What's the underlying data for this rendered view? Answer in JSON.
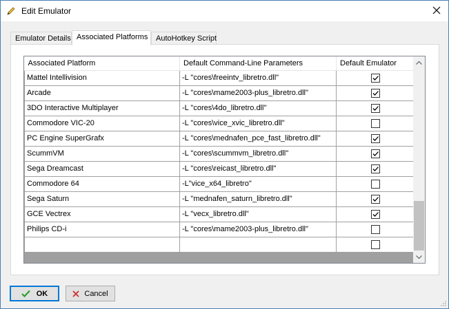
{
  "window": {
    "title": "Edit Emulator",
    "close_glyph": "✕"
  },
  "tabs": [
    {
      "label": "Emulator Details",
      "active": false
    },
    {
      "label": "Associated Platforms",
      "active": true
    },
    {
      "label": "AutoHotkey Script",
      "active": false
    }
  ],
  "grid": {
    "columns": [
      "Associated Platform",
      "Default Command-Line Parameters",
      "Default Emulator"
    ],
    "rows": [
      {
        "platform": "Mattel Intellivision",
        "params": "-L \"cores\\freeintv_libretro.dll\"",
        "default": true
      },
      {
        "platform": "Arcade",
        "params": "-L \"cores\\mame2003-plus_libretro.dll\"",
        "default": true
      },
      {
        "platform": "3DO Interactive Multiplayer",
        "params": "-L \"cores\\4do_libretro.dll\"",
        "default": true
      },
      {
        "platform": "Commodore VIC-20",
        "params": "-L \"cores\\vice_xvic_libretro.dll\"",
        "default": false
      },
      {
        "platform": "PC Engine SuperGrafx",
        "params": "-L \"cores\\mednafen_pce_fast_libretro.dll\"",
        "default": true
      },
      {
        "platform": "ScummVM",
        "params": "-L \"cores\\scummvm_libretro.dll\"",
        "default": true
      },
      {
        "platform": "Sega Dreamcast",
        "params": "-L \"cores\\reicast_libretro.dll\"",
        "default": true
      },
      {
        "platform": "Commodore 64",
        "params": "-L\"vice_x64_libretro\"",
        "default": false
      },
      {
        "platform": "Sega Saturn",
        "params": "-L \"mednafen_saturn_libretro.dll\"",
        "default": true
      },
      {
        "platform": "GCE Vectrex",
        "params": "-L \"vecx_libretro.dll\"",
        "default": true
      },
      {
        "platform": "Philips CD-i",
        "params": "-L \"cores\\mame2003-plus_libretro.dll\"",
        "default": false
      },
      {
        "platform": "",
        "params": "",
        "default": false
      }
    ]
  },
  "buttons": {
    "ok_label": "OK",
    "cancel_label": "Cancel"
  },
  "icons": {
    "title": "pencil-icon",
    "close": "close-icon",
    "ok": "checkmark-icon",
    "cancel": "x-mark-icon",
    "scroll_up": "chevron-up-icon",
    "scroll_down": "chevron-down-icon"
  },
  "colors": {
    "ok_check": "#2e9e2e",
    "cancel_x": "#d03030",
    "accent": "#0078d7"
  }
}
